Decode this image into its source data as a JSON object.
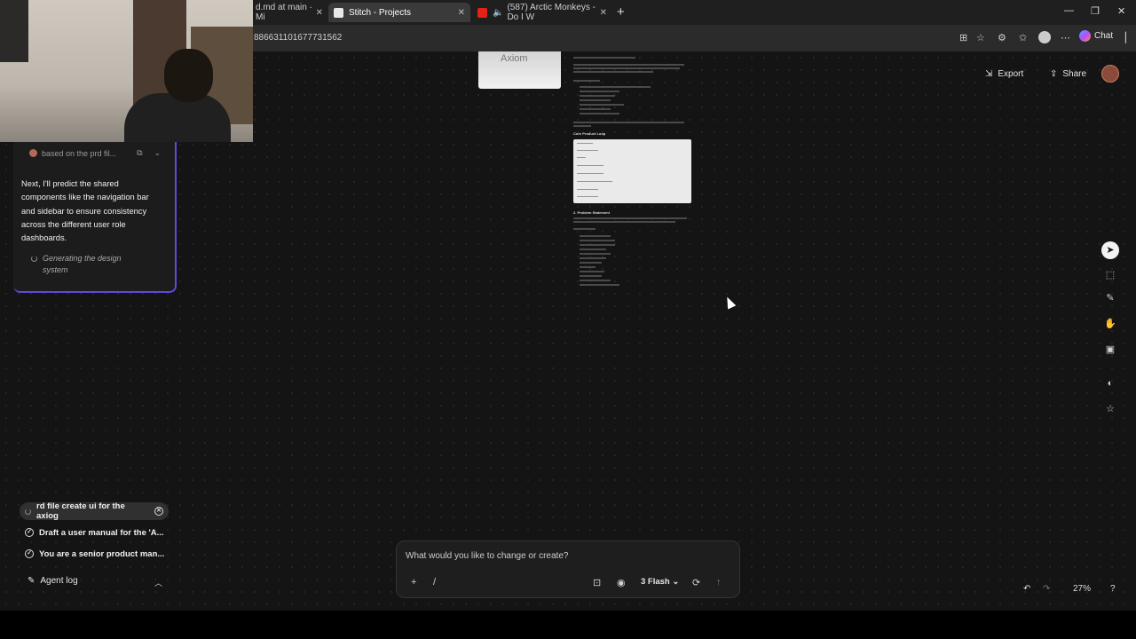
{
  "browser": {
    "tabs": [
      {
        "label": "d.md at main · Mi"
      },
      {
        "label": "Stitch - Projects"
      },
      {
        "label": "(587) Arctic Monkeys - Do I W"
      }
    ],
    "url": "886631101677731562",
    "chat_label": "Chat"
  },
  "toolbar": {
    "export_label": "Export",
    "share_label": "Share"
  },
  "agent_card": {
    "header": "based on the prd fil...",
    "message": "Next, I'll predict the shared components like the navigation bar and sidebar to ensure consistency across the different user role dashboards.",
    "status": "Generating the design system"
  },
  "tasks": [
    {
      "label": "rd file create ui for the axiog",
      "state": "running"
    },
    {
      "label": "Draft a user manual for the 'A...",
      "state": "done"
    },
    {
      "label": "You are a senior product man...",
      "state": "done"
    }
  ],
  "agent_log": {
    "label": "Agent log"
  },
  "canvas": {
    "frame_label": "Axiom",
    "doc_heading_1": "Core Product Loop",
    "doc_heading_2": "2. Problem Statement"
  },
  "composer": {
    "placeholder": "What would you like to change or create?",
    "slash": "/",
    "model_label": "3 Flash"
  },
  "zoom": {
    "level": "27%"
  },
  "colors": {
    "accent": "#5b4cd9",
    "canvas_bg": "#141414"
  }
}
